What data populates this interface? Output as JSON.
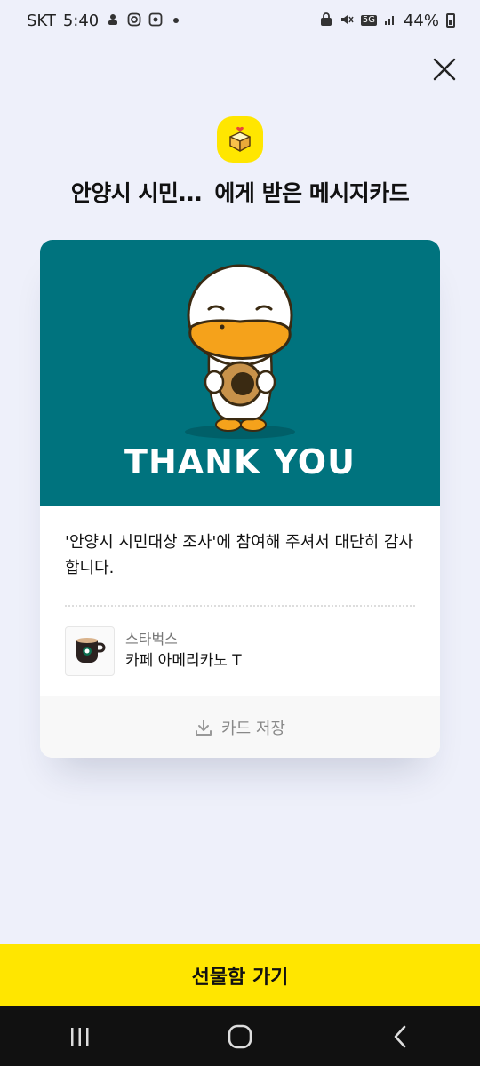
{
  "status_bar": {
    "carrier": "SKT",
    "time": "5:40",
    "network": "5G",
    "battery": "44%"
  },
  "header": {
    "sender": "안양시 시민...",
    "title_suffix": "에게 받은 메시지카드"
  },
  "card": {
    "hero_text": "THANK YOU",
    "hero_color": "#00737e",
    "message": "'안양시 시민대상 조사'에 참여해 주셔서 대단히 감사합니다.",
    "product": {
      "brand": "스타벅스",
      "name": "카페 아메리카노 T"
    },
    "save_label": "카드 저장"
  },
  "cta": {
    "label": "선물함 가기",
    "color": "#ffe600"
  }
}
